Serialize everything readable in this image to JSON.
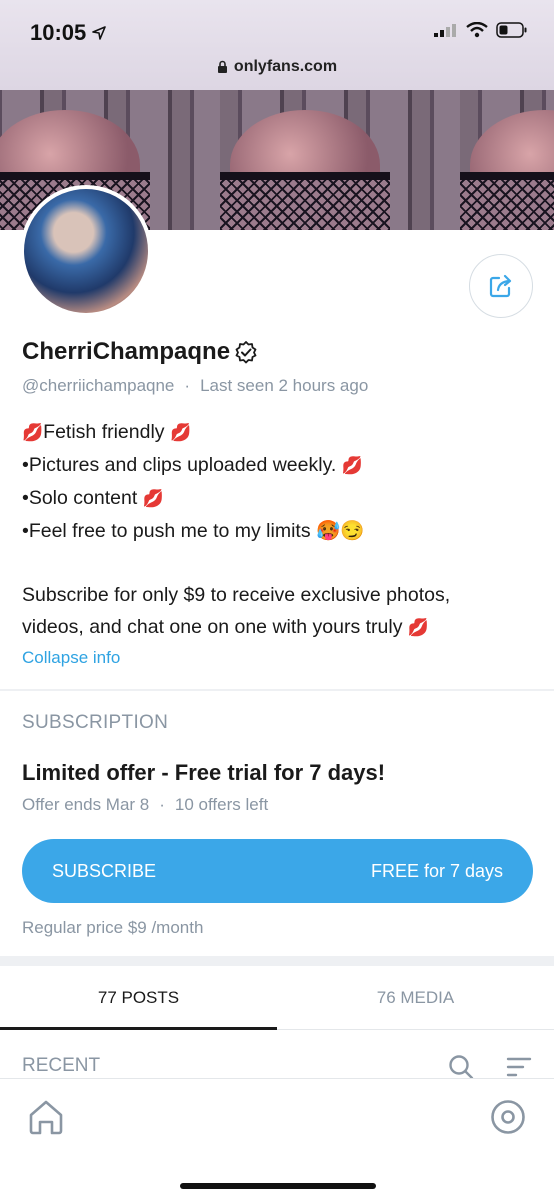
{
  "status_bar": {
    "time": "10:05",
    "url": "onlyfans.com"
  },
  "profile": {
    "name": "CherriChampaqne",
    "handle": "@cherriichampaqne",
    "last_seen": "Last seen 2 hours ago",
    "bio_lines": [
      "Fetish friendly",
      "•Pictures and clips uploaded weekly.",
      "•Solo content",
      "•Feel free to push me to my limits"
    ],
    "bio_paragraph_1": "Subscribe for only $9 to receive exclusive photos,",
    "bio_paragraph_2": "videos, and chat one on one with yours truly",
    "collapse_label": "Collapse info"
  },
  "subscription": {
    "heading": "SUBSCRIPTION",
    "offer_title": "Limited offer - Free trial for 7 days!",
    "offer_ends": "Offer ends Mar 8",
    "offers_left": "10 offers left",
    "button_label": "SUBSCRIBE",
    "button_price": "FREE for 7 days",
    "regular_price": "Regular price $9 /month"
  },
  "tabs": [
    {
      "label": "77 POSTS",
      "active": true
    },
    {
      "label": "76 MEDIA",
      "active": false
    }
  ],
  "feed": {
    "heading": "RECENT"
  },
  "colors": {
    "accent": "#3ba7e8",
    "link": "#2fa3e2",
    "muted": "#8a96a3"
  },
  "icons": [
    "location-arrow-icon",
    "signal-icon",
    "wifi-icon",
    "battery-icon",
    "lock-icon",
    "share-icon",
    "verified-icon",
    "search-icon",
    "sort-icon",
    "home-icon",
    "profile-icon"
  ]
}
